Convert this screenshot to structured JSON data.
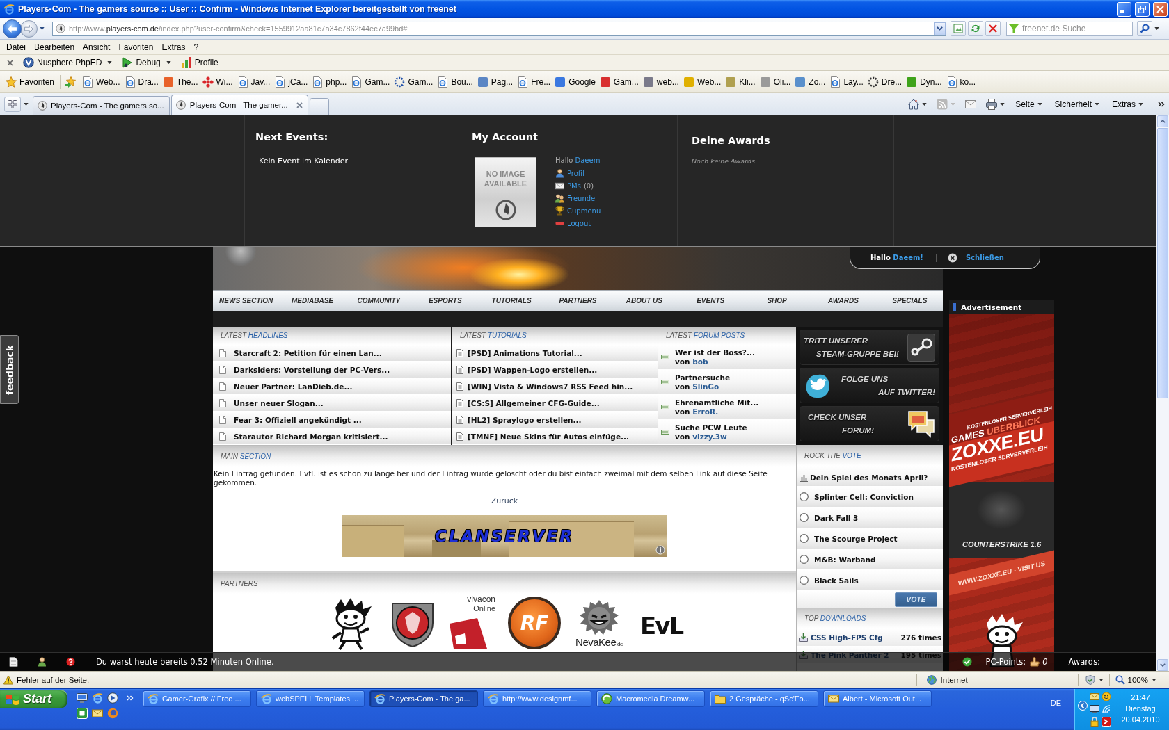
{
  "window": {
    "title": "Players-Com - The gamers source :: User :: Confirm - Windows Internet Explorer bereitgestellt von freenet"
  },
  "address_bar": {
    "url_prefix": "http://www.",
    "url_domain": "players-com.de",
    "url_path": "/index.php?user-confirm&check=1559912aa81c7a34c7862f44ec7a99bd#",
    "search_placeholder": "freenet.de Suche"
  },
  "menu_bar": [
    "Datei",
    "Bearbeiten",
    "Ansicht",
    "Favoriten",
    "Extras",
    "?"
  ],
  "toolbar": [
    {
      "kind": "phped",
      "label": "Nusphere PhpED",
      "menu": true
    },
    {
      "kind": "debug",
      "label": "Debug",
      "menu": true
    },
    {
      "kind": "profile",
      "label": "Profile",
      "menu": false
    }
  ],
  "favorites_bar": {
    "label": "Favoriten",
    "items": [
      {
        "kind": "ie",
        "label": "Web..."
      },
      {
        "kind": "ie",
        "label": "Dra..."
      },
      {
        "kind": "tile",
        "color": "#e8622a",
        "label": "The..."
      },
      {
        "kind": "dots",
        "color": "#d8262a",
        "label": "Wi..."
      },
      {
        "kind": "ie",
        "label": "Jav..."
      },
      {
        "kind": "ie",
        "label": "jCa..."
      },
      {
        "kind": "ie",
        "label": "php..."
      },
      {
        "kind": "ie",
        "label": "Gam..."
      },
      {
        "kind": "ring",
        "color": "#1f4fa8",
        "label": "Gam..."
      },
      {
        "kind": "ie",
        "label": "Bou..."
      },
      {
        "kind": "tile",
        "color": "#5b86c4",
        "label": "Pag..."
      },
      {
        "kind": "ie",
        "label": "Fre..."
      },
      {
        "kind": "tile",
        "color": "#3a78e0",
        "label": "Google"
      },
      {
        "kind": "tile",
        "color": "#d83030",
        "label": "Gam..."
      },
      {
        "kind": "tile",
        "color": "#7a7a8a",
        "label": "web..."
      },
      {
        "kind": "tile",
        "color": "#e0b000",
        "label": "Web..."
      },
      {
        "kind": "tile",
        "color": "#b0a050",
        "label": "Kli..."
      },
      {
        "kind": "tile",
        "color": "#9a9a9a",
        "label": "Oli..."
      },
      {
        "kind": "tile",
        "color": "#5a90cc",
        "label": "Zo..."
      },
      {
        "kind": "ie",
        "label": "Lay..."
      },
      {
        "kind": "ring",
        "color": "#333333",
        "label": "Dre..."
      },
      {
        "kind": "tile",
        "color": "#3fa31a",
        "label": "Dyn..."
      },
      {
        "kind": "ie",
        "label": "ko..."
      }
    ]
  },
  "tabs": [
    {
      "label": "Players-Com - The gamers so...",
      "selected": false
    },
    {
      "label": "Players-Com - The gamer...",
      "selected": true
    }
  ],
  "command_bar": [
    "Seite",
    "Sicherheit",
    "Extras"
  ],
  "top_panel": {
    "events": {
      "title": "Next Events:",
      "text": "Kein Event im Kalender"
    },
    "account": {
      "title": "My Account",
      "image_text": "NO IMAGE AVAILABLE",
      "greeting": "Hallo",
      "user": "Daeem",
      "links": [
        {
          "kind": "profile",
          "label": "Profil"
        },
        {
          "kind": "messages",
          "label": "PMs",
          "count": "(0)"
        },
        {
          "kind": "friends",
          "label": "Freunde"
        },
        {
          "kind": "cup",
          "label": "Cupmenu"
        },
        {
          "kind": "logout",
          "label": "Logout"
        }
      ]
    },
    "awards": {
      "title": "Deine Awards",
      "text": "Noch keine Awards"
    }
  },
  "welcome_tab": {
    "greeting": "Hallo",
    "user": "Daeem!",
    "close": "Schließen"
  },
  "feedback_tab": "feedback",
  "nav": [
    "NEWS SECTION",
    "MEDIABASE",
    "COMMUNITY",
    "ESPORTS",
    "TUTORIALS",
    "PARTNERS",
    "ABOUT US",
    "EVENTS",
    "SHOP",
    "AWARDS",
    "SPECIALS"
  ],
  "headlines": {
    "title": "LATEST",
    "accent": "HEADLINES",
    "items": [
      "Starcraft 2: Petition für einen Lan...",
      "Darksiders: Vorstellung der PC-Vers...",
      "Neuer Partner: LanDieb.de...",
      "Unser neuer Slogan...",
      "Fear 3: Offiziell angekündigt ...",
      "Starautor Richard Morgan kritisiert..."
    ]
  },
  "tutorials": {
    "title": "LATEST",
    "accent": "TUTORIALS",
    "items": [
      "[PSD] Animations Tutorial...",
      "[PSD] Wappen-Logo erstellen...",
      "[WIN] Vista & Windows7 RSS Feed hin...",
      "[CS:S] Allgemeiner CFG-Guide...",
      "[HL2] Spraylogo erstellen...",
      "[TMNF] Neue Skins für Autos einfüge..."
    ]
  },
  "forum": {
    "title": "LATEST",
    "accent": "FORUM POSTS",
    "items": [
      {
        "title": "Wer ist der Boss?...",
        "by": "von",
        "author": "bob"
      },
      {
        "title": "Partnersuche",
        "by": "von",
        "author": "SlinGo"
      },
      {
        "title": "Ehrenamtliche Mit...",
        "by": "von",
        "author": "ErroR."
      },
      {
        "title": "Suche PCW Leute",
        "by": "von",
        "author": "vizzy.3w"
      }
    ]
  },
  "promo": [
    {
      "kind": "steam",
      "line1": "TRITT UNSERER",
      "line2": "STEAM-GRUPPE BEI!"
    },
    {
      "kind": "twitter",
      "line1": "FOLGE UNS",
      "line2": "AUF TWITTER!"
    },
    {
      "kind": "forum",
      "line1": "CHECK UNSER",
      "line2": "FORUM!"
    }
  ],
  "main_section": {
    "title": "MAIN",
    "accent": "SECTION",
    "message": "Kein Eintrag gefunden. Evtl. ist es schon zu lange her und der Eintrag wurde gelöscht oder du bist einfach zweimal mit dem selben Link auf diese Seite gekommen.",
    "back_link": "Zurück",
    "banner_text": "CLANSERVER"
  },
  "partners": {
    "title": "PARTNERS",
    "logos": [
      {
        "kind": "mascot"
      },
      {
        "kind": "shield"
      },
      {
        "kind": "vivacon",
        "text": "vivacon",
        "subtext": "Online"
      },
      {
        "kind": "disc",
        "text": "RF"
      },
      {
        "kind": "ball",
        "text": "NevaKee",
        "subtext": ".de"
      },
      {
        "kind": "letters",
        "text": "EvL"
      }
    ]
  },
  "vote": {
    "title": "ROCK THE",
    "accent": "VOTE",
    "question": "Dein Spiel des Monats April?",
    "options": [
      {
        "label": "Splinter Cell: Conviction",
        "selected": false
      },
      {
        "label": "Dark Fall 3",
        "selected": false
      },
      {
        "label": "The Scourge Project",
        "selected": false
      },
      {
        "label": "M&B: Warband",
        "selected": false
      },
      {
        "label": "Black Sails",
        "selected": false
      }
    ],
    "button": "VOTE"
  },
  "downloads": {
    "title": "TOP",
    "accent": "DOWNLOADS",
    "items": [
      {
        "name": "CSS High-FPS Cfg",
        "count": "276 times"
      },
      {
        "name": "The Pink Panther 2",
        "count": "195 times"
      }
    ]
  },
  "advertisement": {
    "label": "Advertisement",
    "top_line": "KOSTENLOSER SERVERVERLEIH",
    "headline": "GAMES",
    "headline_accent": "UBERBLICK",
    "brand": "ZOXXE.EU",
    "tagline": "KOSTENLOSER SERVERVERLEIH",
    "game": "COUNTERSTRIKE 1.6",
    "url_line": "WWW.ZOXXE.EU - VISIT US"
  },
  "site_bar": {
    "message": "Du warst heute bereits 0.52 Minuten Online.",
    "points_label": "PC-Points:",
    "points": "0",
    "awards_label": "Awards:"
  },
  "status_bar": {
    "message": "Fehler auf der Seite.",
    "zone": "Internet",
    "zoom": "100%"
  },
  "taskbar": {
    "start": "Start",
    "tasks": [
      {
        "kind": "ie",
        "label": "Gamer-Grafix // Free ...",
        "selected": false
      },
      {
        "kind": "ie",
        "label": "webSPELL Templates ...",
        "selected": false
      },
      {
        "kind": "ie",
        "label": "Players-Com - The ga...",
        "selected": true
      },
      {
        "kind": "ie",
        "label": "http://www.designmf...",
        "selected": false
      },
      {
        "kind": "dw",
        "label": "Macromedia Dreamw...",
        "selected": false
      },
      {
        "kind": "chat",
        "label": "2 Gespräche - qSc'Fo...",
        "selected": false
      },
      {
        "kind": "mail",
        "label": "Albert - Microsoft Out...",
        "selected": false
      }
    ],
    "language": "DE",
    "time": "21:47",
    "day": "Dienstag",
    "date": "20.04.2010"
  }
}
